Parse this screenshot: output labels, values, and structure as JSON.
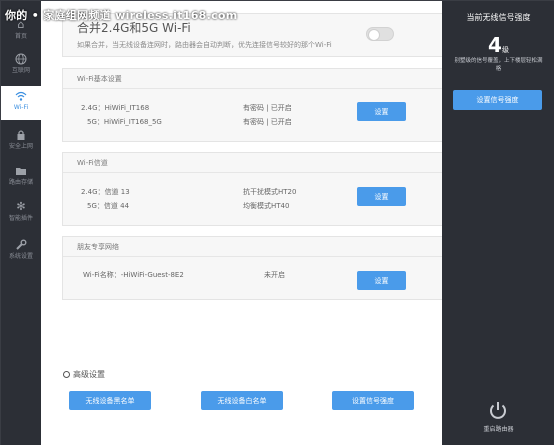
{
  "watermark": "你的 • 家庭组网频道 wireless.it168.com",
  "sidebar": {
    "items": [
      {
        "label": "首页",
        "icon": "home-icon"
      },
      {
        "label": "互联网",
        "icon": "globe-icon"
      },
      {
        "label": "Wi-Fi",
        "icon": "wifi-icon"
      },
      {
        "label": "安全上网",
        "icon": "lock-icon"
      },
      {
        "label": "路由存储",
        "icon": "folder-icon"
      },
      {
        "label": "智能插件",
        "icon": "plugin-icon"
      },
      {
        "label": "系统设置",
        "icon": "wrench-icon"
      }
    ]
  },
  "merge": {
    "title": "合并2.4G和5G Wi-Fi",
    "desc": "如果合并，当无线设备连网时，路由器会自动判断，优先连接信号较好的那个Wi-Fi"
  },
  "basic": {
    "title": "Wi-Fi基本设置",
    "row1": {
      "band": "2.4G：",
      "ssid": "HiWiFi_IT168",
      "status": "有密码 | 已开启"
    },
    "row2": {
      "band": "5G：",
      "ssid": "HiWiFi_IT168_5G",
      "status": "有密码 | 已开启"
    },
    "button": "设置"
  },
  "channel": {
    "title": "Wi-Fi信道",
    "row1": {
      "band": "2.4G：",
      "channel": "信道 13",
      "mode": "抗干扰模式HT20"
    },
    "row2": {
      "band": "5G：",
      "channel": "信道 44",
      "mode": "均衡模式HT40"
    },
    "button": "设置"
  },
  "guest": {
    "title": "朋友专享网络",
    "name": "Wi-Fi名称：-HiWiFi-Guest-8E2",
    "status": "未开启",
    "button": "设置"
  },
  "advanced": {
    "title": "高级设置",
    "blacklist": "无线设备黑名单",
    "whitelist": "无线设备白名单",
    "signal": "设置信号强度"
  },
  "right": {
    "title": "当前无线信号强度",
    "level": "4",
    "level_unit": "级",
    "desc": "别墅级的信号覆盖，上下楼层轻松满格",
    "button": "设置信号强度",
    "restart": "重启路由器"
  },
  "colors": {
    "accent": "#4a9bea",
    "sidebar_bg": "#2c2f36"
  }
}
